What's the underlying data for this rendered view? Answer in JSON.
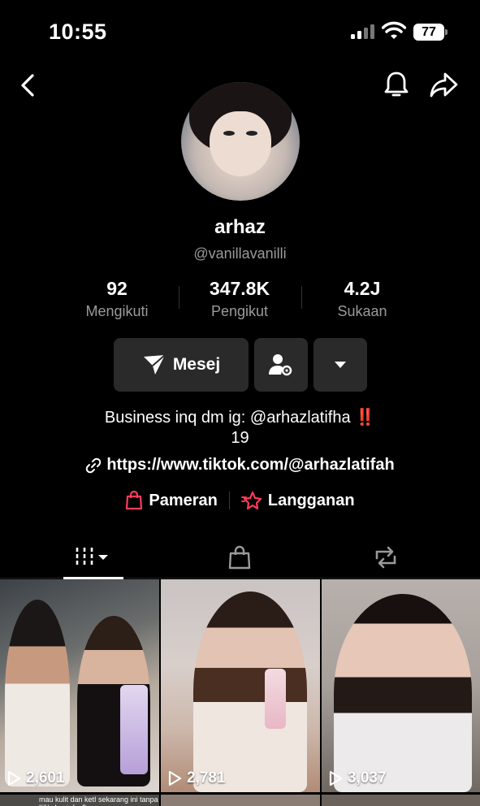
{
  "status_bar": {
    "time": "10:55",
    "battery": "77"
  },
  "profile": {
    "name": "arhaz",
    "handle": "@vanillavanilli",
    "stats": [
      {
        "value": "92",
        "label": "Mengikuti"
      },
      {
        "value": "347.8K",
        "label": "Pengikut"
      },
      {
        "value": "4.2J",
        "label": "Sukaan"
      }
    ]
  },
  "actions": {
    "message_label": "Mesej"
  },
  "bio": {
    "line1": "Business inq dm ig: @arhazlatifha",
    "emoji": "‼️",
    "line2": "19",
    "link": "https://www.tiktok.com/@arhazlatifah"
  },
  "shop_links": {
    "showcase": "Pameran",
    "subscription": "Langganan"
  },
  "videos": [
    {
      "views": "2,601"
    },
    {
      "views": "2,781"
    },
    {
      "views": "3,037"
    }
  ],
  "second_row_caption": "mau kulit dan ketI sekarang ini tanpa lli% dan infus?",
  "colors": {
    "accent_red": "#e0313b",
    "pink_icon": "#ff3b5c"
  }
}
